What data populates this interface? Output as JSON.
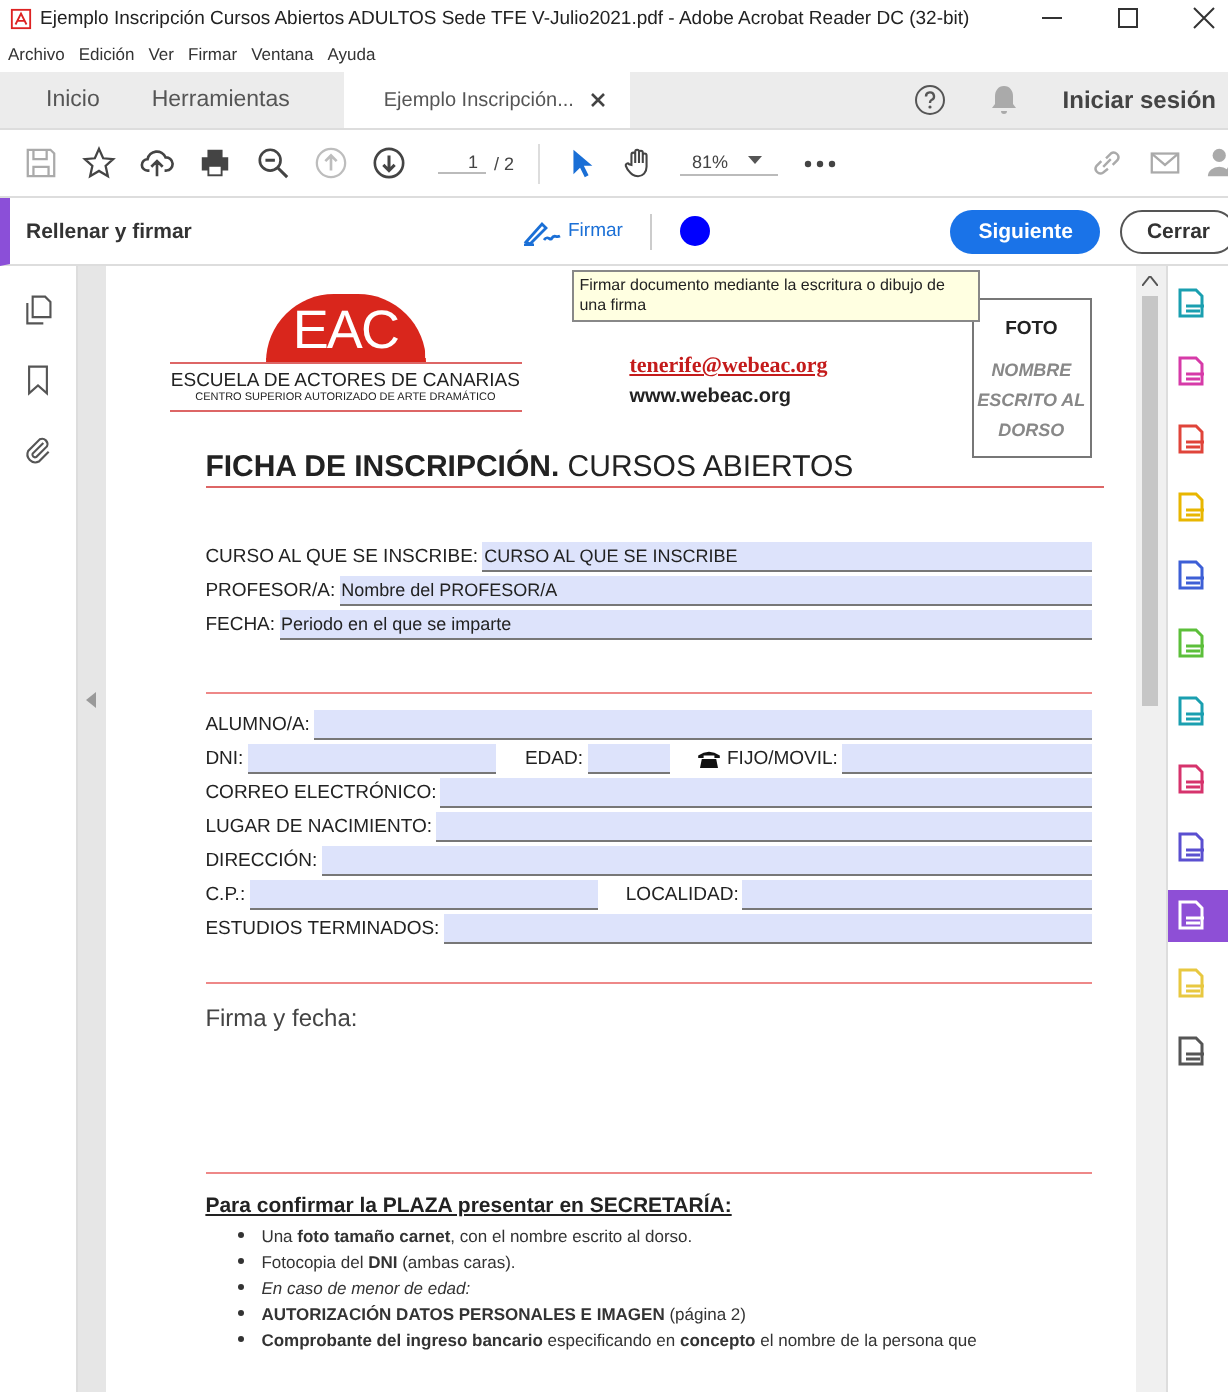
{
  "window": {
    "title": "Ejemplo Inscripción Cursos Abiertos ADULTOS Sede TFE V-Julio2021.pdf - Adobe Acrobat Reader DC (32-bit)"
  },
  "menu": [
    "Archivo",
    "Edición",
    "Ver",
    "Firmar",
    "Ventana",
    "Ayuda"
  ],
  "tabs": [
    {
      "label": "Inicio",
      "selected": false,
      "closable": false
    },
    {
      "label": "Herramientas",
      "selected": false,
      "closable": false
    },
    {
      "label": "Ejemplo Inscripción...",
      "selected": true,
      "closable": true
    }
  ],
  "sign_in": "Iniciar sesión",
  "toolbar": {
    "page": "1",
    "page_total": "/ 2",
    "zoom": "81%",
    "prev_disabled": true
  },
  "fill_sign": {
    "title": "Rellenar y firmar",
    "sign": "Firmar",
    "color": "#0000ff",
    "next": "Siguiente",
    "close": "Cerrar"
  },
  "tooltip": "Firmar documento mediante la escritura o dibujo de una firma",
  "document": {
    "school": "ESCUELA DE ACTORES DE CANARIAS",
    "school_sub": "CENTRO SUPERIOR AUTORIZADO DE ARTE DRAMÁTICO",
    "logo": "EAC",
    "email": "tenerife@webeac.org",
    "web": "www.webeac.org",
    "photo_title": "FOTO",
    "photo_note": "NOMBRE ESCRITO AL DORSO",
    "heading": "**FICHA DE INSCRIPCIÓN.** CURSOS ABIERTOS",
    "course_rows": [
      [
        {
          "label": "CURSO AL QUE SE INSCRIBE:",
          "value": "CURSO AL QUE SE INSCRIBE"
        }
      ],
      [
        {
          "label": "PROFESOR/A:",
          "value": "Nombre del PROFESOR/A"
        }
      ],
      [
        {
          "label": "FECHA:",
          "value": "Periodo en el que se imparte"
        }
      ]
    ],
    "student_rows": [
      [
        {
          "label": "ALUMNO/A:",
          "kind": "text"
        }
      ],
      [
        {
          "label": "DNI:",
          "kind": "text"
        },
        {
          "label": "EDAD:",
          "kind": "short"
        },
        {
          "label": "FIJO/MOVIL:",
          "kind": "phone"
        }
      ],
      [
        {
          "label": "CORREO ELECTRÓNICO:",
          "kind": "text"
        }
      ],
      [
        {
          "label": "LUGAR DE NACIMIENTO:",
          "kind": "text"
        }
      ],
      [
        {
          "label": "DIRECCIÓN:",
          "kind": "text"
        }
      ],
      [
        {
          "label": "C.P.:",
          "kind": "text"
        },
        {
          "label": "LOCALIDAD:",
          "kind": "text"
        }
      ],
      [
        {
          "label": "ESTUDIOS TERMINADOS:",
          "kind": "text"
        }
      ]
    ],
    "signature_label": "Firma y fecha:",
    "requirements_title": "Para confirmar la PLAZA presentar en SECRETARÍA:",
    "requirements": [
      {
        "text": "Una **foto tamaño carnet**, con el nombre escrito al dorso.",
        "kind": "plain"
      },
      {
        "text": "Fotocopia del **DNI** (ambas caras).",
        "kind": "plain"
      },
      {
        "text": "En caso de menor de edad:",
        "kind": "note"
      },
      {
        "text": "**AUTORIZACIÓN DATOS PERSONALES E IMAGEN** (página 2)",
        "kind": "plain"
      },
      {
        "text": "**Comprobante del ingreso bancario** especificando en **concepto** el nombre de la persona que",
        "kind": "plain"
      }
    ]
  },
  "right_tools": [
    {
      "color": "#1a9fb0",
      "selected": false
    },
    {
      "color": "#d63aa8",
      "selected": false
    },
    {
      "color": "#e0443a",
      "selected": false
    },
    {
      "color": "#e8b600",
      "selected": false
    },
    {
      "color": "#3d5fd6",
      "selected": false
    },
    {
      "color": "#5cbf3a",
      "selected": false
    },
    {
      "color": "#1a9fb0",
      "selected": false
    },
    {
      "color": "#d6336c",
      "selected": false
    },
    {
      "color": "#5a4fd0",
      "selected": false
    },
    {
      "color": "#8e4fd6",
      "selected": true
    },
    {
      "color": "#e8c840",
      "selected": false
    },
    {
      "color": "#555555",
      "selected": false
    }
  ]
}
